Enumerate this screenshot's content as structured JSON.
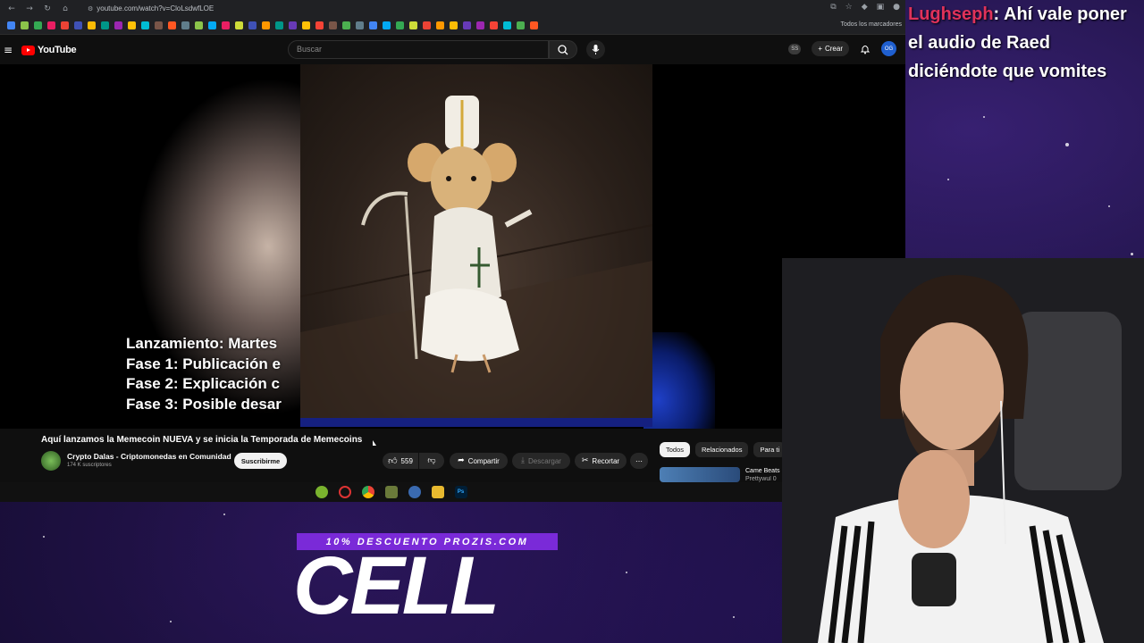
{
  "browser": {
    "url": "youtube.com/watch?v=CloLsdwfLOE",
    "bookmarks_folder": "Todos los marcadores",
    "bookmark_colors": [
      "#4285f4",
      "#34a853",
      "#ea4335",
      "#fbbc05",
      "#9c27b0",
      "#00bcd4",
      "#ff5722",
      "#8bc34a",
      "#e91e63",
      "#3f51b5",
      "#009688",
      "#ffc107",
      "#795548",
      "#607d8b",
      "#03a9f4",
      "#cddc39",
      "#ff9800",
      "#673ab7",
      "#f44336",
      "#4caf50"
    ]
  },
  "youtube": {
    "logo_text": "YouTube",
    "search_placeholder": "Buscar",
    "ss_badge": "SS",
    "create_label": "Crear",
    "avatar_initials": "OG"
  },
  "video": {
    "overlay_lines": [
      "Lanzamiento: Martes",
      "Fase 1: Publicación e",
      "Fase 2: Explicación c",
      "Fase 3: Posible desar"
    ],
    "title": "Aquí lanzamos la Memecoin NUEVA y se inicia la Temporada de Memecoins",
    "channel_name": "Crypto Dalas - Criptomonedas en Comunidad",
    "subscribers": "174 K suscriptores",
    "subscribe_label": "Suscribirme",
    "likes": "559",
    "share_label": "Compartir",
    "download_label": "Descargar",
    "clip_label": "Recortar"
  },
  "sidebar": {
    "chips": [
      "Todos",
      "Relacionados",
      "Para ti"
    ],
    "rec_title": "Came Beats",
    "rec_subtitle": "Prettywul 0"
  },
  "chat": {
    "username": "Lughseph",
    "line1": ": Ahí vale poner",
    "line2": "el audio de Raed",
    "line3": "diciéndote que vomites"
  },
  "promo": {
    "band_text": "10% DESCUENTO PROZIS.COM",
    "big_text": "CELL"
  },
  "taskbar": {
    "photoshop_label": "Ps"
  }
}
